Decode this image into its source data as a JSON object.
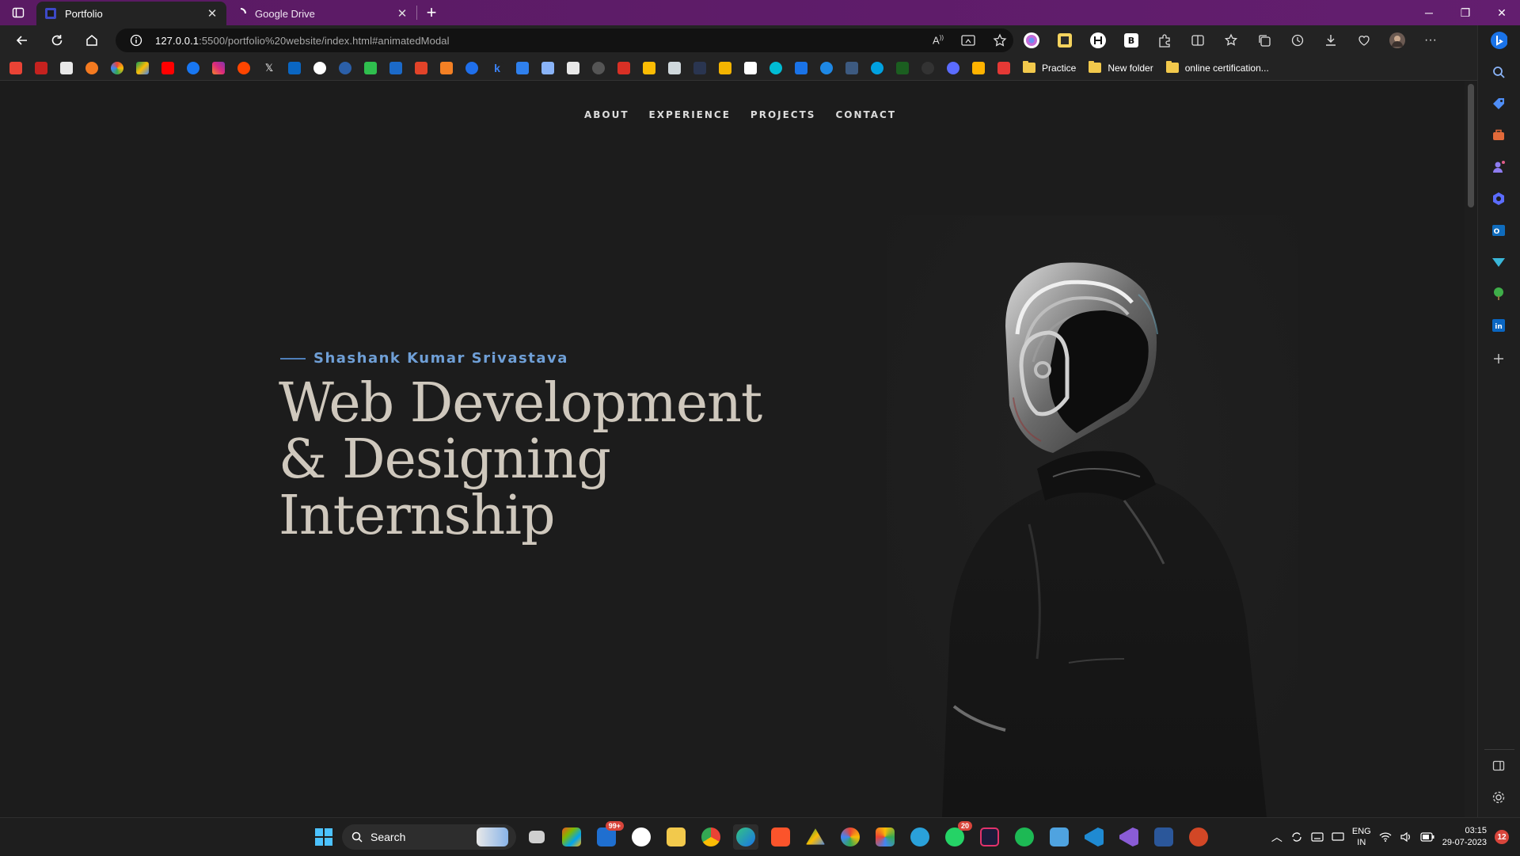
{
  "browser": {
    "tabs": [
      {
        "title": "Portfolio",
        "active": true
      },
      {
        "title": "Google Drive",
        "active": false
      }
    ],
    "url_host": "127.0.0.1",
    "url_rest": ":5500/portfolio%20website/index.html#animatedModal",
    "bookmark_folders": [
      "Practice",
      "New folder",
      "online certification..."
    ]
  },
  "site": {
    "nav": [
      "ABOUT",
      "EXPERIENCE",
      "PROJECTS",
      "CONTACT"
    ],
    "author": "Shashank Kumar Srivastava",
    "title_lines": [
      "Web Development",
      "& Designing",
      "Internship"
    ]
  },
  "taskbar": {
    "search_label": "Search",
    "mail_badge": "99+",
    "whatsapp_badge": "20",
    "lang_line1": "ENG",
    "lang_line2": "IN",
    "time": "03:15",
    "date": "29-07-2023",
    "notifications": "12"
  },
  "colors": {
    "tabbar": "#5e1c69",
    "page_bg": "#1c1c1c",
    "accent": "#6f9fd6",
    "title": "#cfc8bd"
  }
}
